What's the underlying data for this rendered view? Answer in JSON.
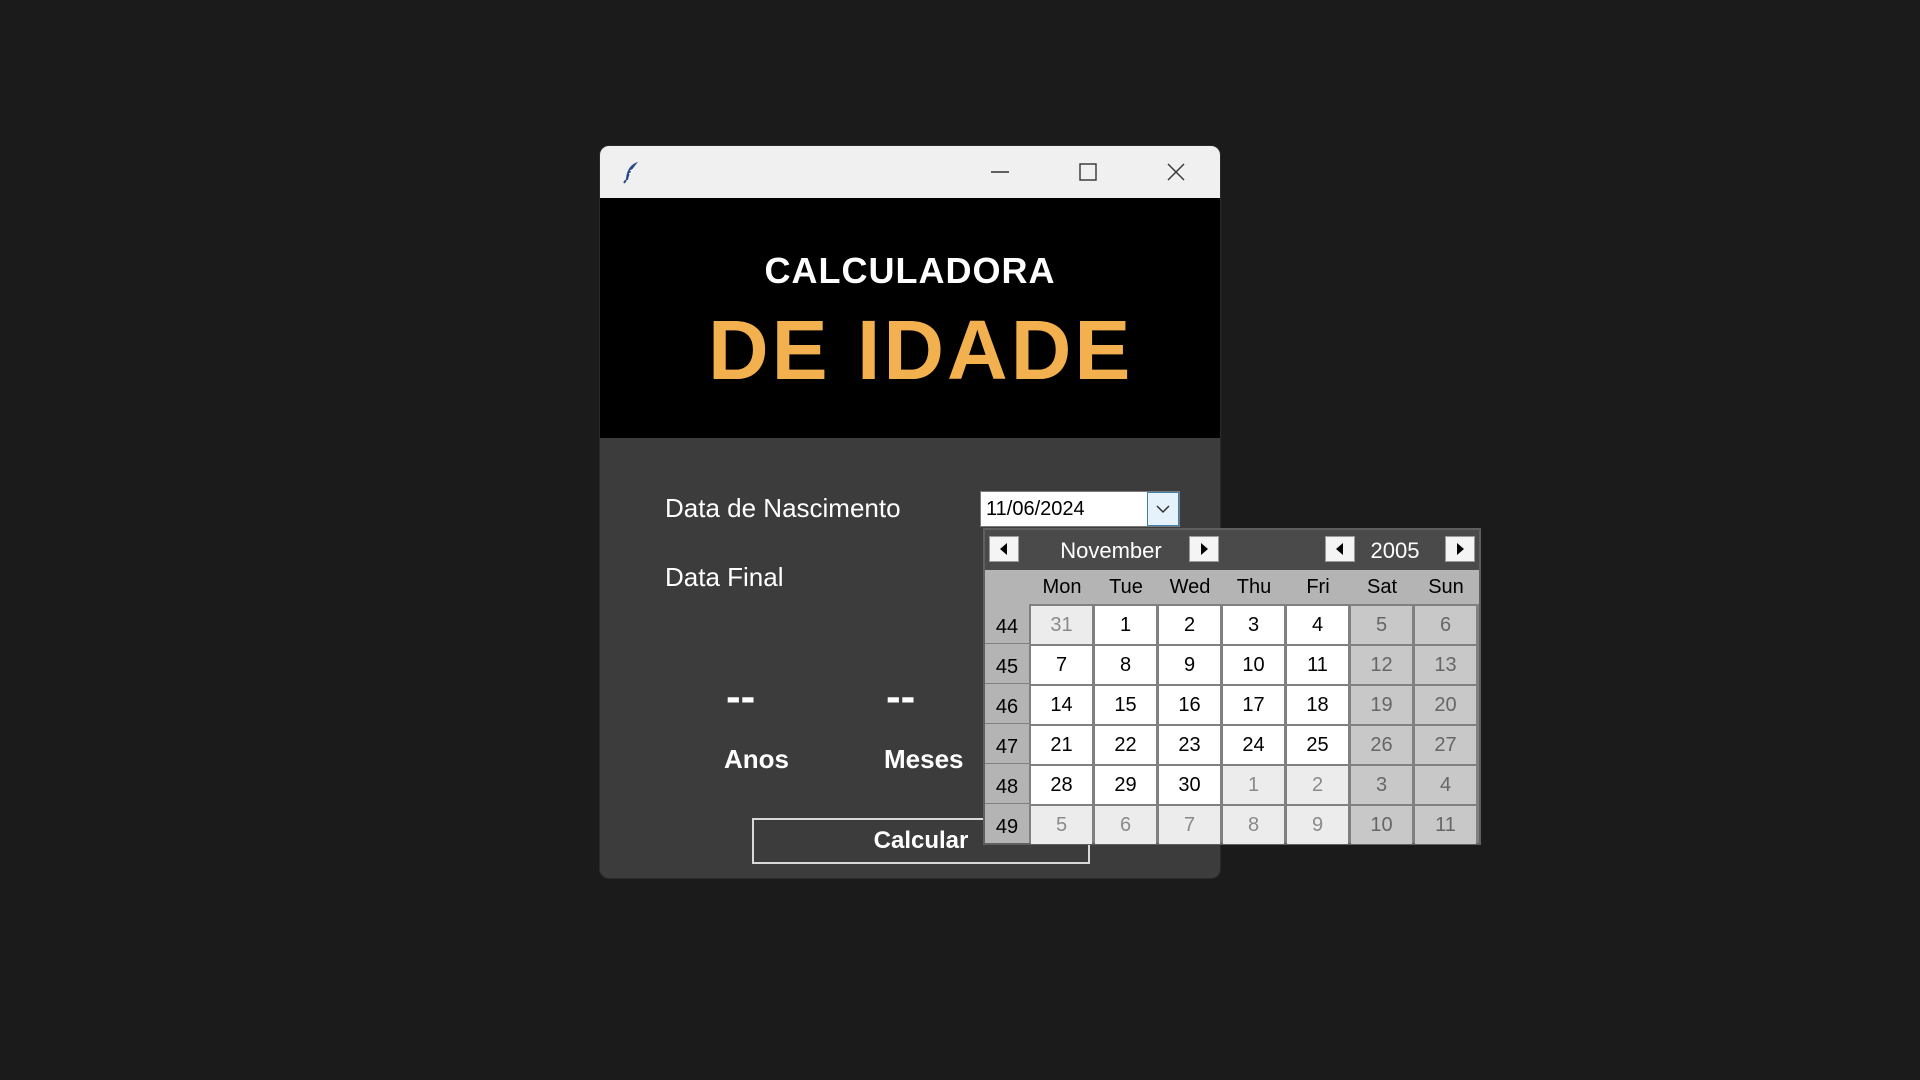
{
  "window": {
    "title_icon": "feather-icon",
    "controls": {
      "minimize": "minimize-icon",
      "maximize": "maximize-icon",
      "close": "close-icon"
    }
  },
  "banner": {
    "title_small": "CALCULADORA",
    "title_big": "DE IDADE",
    "accent_color": "#f2b04e"
  },
  "form": {
    "birth_label": "Data de Nascimento",
    "birth_value": "11/06/2024",
    "end_label": "Data Final"
  },
  "results": {
    "years_value": "--",
    "years_label": "Anos",
    "months_value": "--",
    "months_label": "Meses"
  },
  "calculate_label": "Calcular",
  "calendar": {
    "month": "November",
    "year": "2005",
    "weekdays": [
      "Mon",
      "Tue",
      "Wed",
      "Thu",
      "Fri",
      "Sat",
      "Sun"
    ],
    "weeks": [
      {
        "num": "44",
        "days": [
          [
            "31",
            "oth"
          ],
          [
            "1",
            "cur"
          ],
          [
            "2",
            "cur"
          ],
          [
            "3",
            "cur"
          ],
          [
            "4",
            "cur"
          ],
          [
            "5",
            "we"
          ],
          [
            "6",
            "we"
          ]
        ]
      },
      {
        "num": "45",
        "days": [
          [
            "7",
            "cur"
          ],
          [
            "8",
            "cur"
          ],
          [
            "9",
            "cur"
          ],
          [
            "10",
            "cur"
          ],
          [
            "11",
            "cur"
          ],
          [
            "12",
            "we"
          ],
          [
            "13",
            "we"
          ]
        ]
      },
      {
        "num": "46",
        "days": [
          [
            "14",
            "cur"
          ],
          [
            "15",
            "cur"
          ],
          [
            "16",
            "cur"
          ],
          [
            "17",
            "cur"
          ],
          [
            "18",
            "cur"
          ],
          [
            "19",
            "we"
          ],
          [
            "20",
            "we"
          ]
        ]
      },
      {
        "num": "47",
        "days": [
          [
            "21",
            "cur"
          ],
          [
            "22",
            "cur"
          ],
          [
            "23",
            "cur"
          ],
          [
            "24",
            "cur"
          ],
          [
            "25",
            "cur"
          ],
          [
            "26",
            "we"
          ],
          [
            "27",
            "we"
          ]
        ]
      },
      {
        "num": "48",
        "days": [
          [
            "28",
            "cur"
          ],
          [
            "29",
            "cur"
          ],
          [
            "30",
            "cur"
          ],
          [
            "1",
            "oth"
          ],
          [
            "2",
            "oth"
          ],
          [
            "3",
            "we"
          ],
          [
            "4",
            "we"
          ]
        ]
      },
      {
        "num": "49",
        "days": [
          [
            "5",
            "oth"
          ],
          [
            "6",
            "oth"
          ],
          [
            "7",
            "oth"
          ],
          [
            "8",
            "oth"
          ],
          [
            "9",
            "oth"
          ],
          [
            "10",
            "we"
          ],
          [
            "11",
            "we"
          ]
        ]
      }
    ]
  }
}
